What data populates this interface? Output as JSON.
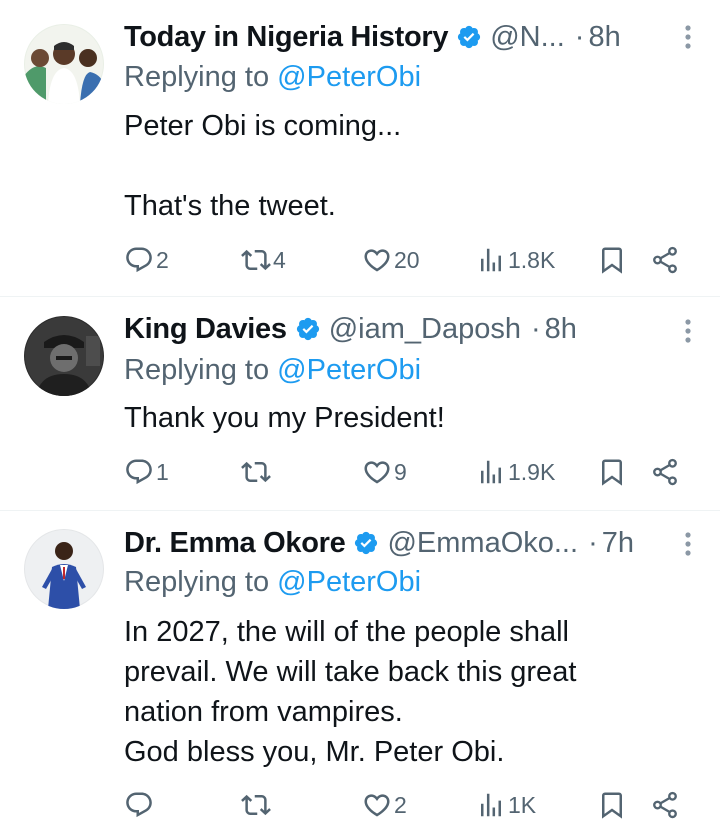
{
  "tweets": [
    {
      "name": "Today in Nigeria History",
      "handle": "@N...",
      "separator": "·",
      "time": "8h",
      "replying_prefix": "Replying to",
      "replying_to": "@PeterObi",
      "body": [
        "Peter Obi is coming...",
        "",
        "That's the tweet."
      ],
      "replies": "2",
      "retweets": "4",
      "likes": "20",
      "views": "1.8K"
    },
    {
      "name": "King Davies",
      "handle": "@iam_Daposh",
      "separator": "·",
      "time": "8h",
      "replying_prefix": "Replying to",
      "replying_to": "@PeterObi",
      "body": [
        "Thank you my President!"
      ],
      "replies": "1",
      "retweets": "",
      "likes": "9",
      "views": "1.9K"
    },
    {
      "name": "Dr. Emma Okore",
      "handle": "@EmmaOko...",
      "separator": "·",
      "time": "7h",
      "replying_prefix": "Replying to",
      "replying_to": "@PeterObi",
      "body": [
        "In 2027, the will of the people shall",
        "prevail. We will take back this great",
        "nation from vampires.",
        "God bless you, Mr. Peter Obi."
      ],
      "replies": "",
      "retweets": "",
      "likes": "2",
      "views": "1K"
    }
  ],
  "colors": {
    "text": "#0f1419",
    "secondary": "#536471",
    "link": "#1d9bf0",
    "verified": "#1d9bf0",
    "divider": "#eff3f4"
  },
  "icons": [
    "verified-badge-icon",
    "more-options-icon",
    "reply-icon",
    "retweet-icon",
    "like-icon",
    "views-icon",
    "bookmark-icon",
    "share-icon"
  ]
}
